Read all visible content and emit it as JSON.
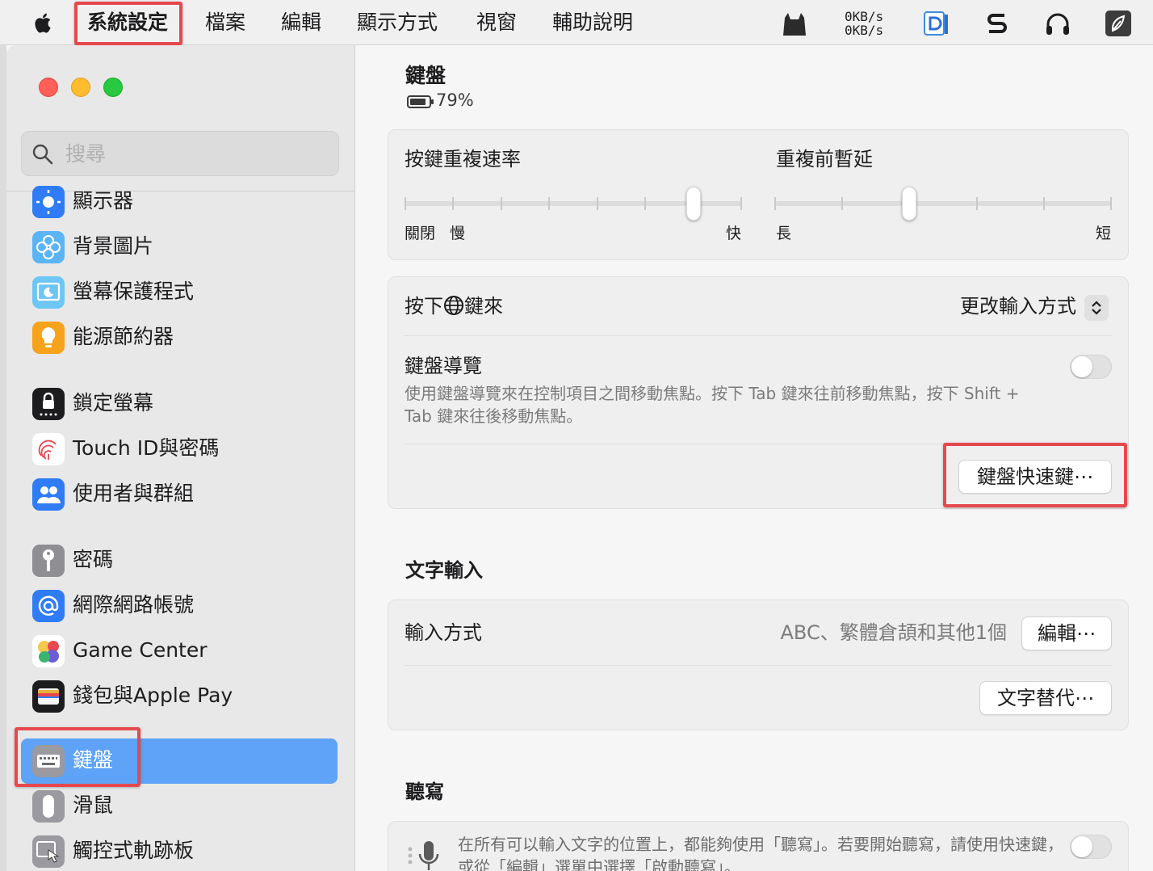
{
  "menubar": {
    "app_name": "系統設定",
    "items": [
      "檔案",
      "編輯",
      "顯示方式",
      "視窗",
      "輔助說明"
    ],
    "net_up": "0KB/s",
    "net_down": "0KB/s"
  },
  "sidebar": {
    "search_placeholder": "搜尋",
    "items": [
      {
        "label": "顯示器",
        "icon": "display-brightness-icon"
      },
      {
        "label": "背景圖片",
        "icon": "wallpaper-flower-icon"
      },
      {
        "label": "螢幕保護程式",
        "icon": "screensaver-icon"
      },
      {
        "label": "能源節約器",
        "icon": "lightbulb-icon"
      },
      {
        "label": "鎖定螢幕",
        "icon": "lock-screen-icon"
      },
      {
        "label": "Touch ID與密碼",
        "icon": "fingerprint-icon"
      },
      {
        "label": "使用者與群組",
        "icon": "users-icon"
      },
      {
        "label": "密碼",
        "icon": "key-icon"
      },
      {
        "label": "網際網路帳號",
        "icon": "at-sign-icon"
      },
      {
        "label": "Game Center",
        "icon": "game-center-icon"
      },
      {
        "label": "錢包與Apple Pay",
        "icon": "wallet-icon"
      },
      {
        "label": "鍵盤",
        "icon": "keyboard-icon",
        "selected": true
      },
      {
        "label": "滑鼠",
        "icon": "mouse-icon"
      },
      {
        "label": "觸控式軌跡板",
        "icon": "trackpad-icon"
      }
    ]
  },
  "content": {
    "title": "鍵盤",
    "battery_percent": "79%",
    "key_repeat": {
      "label": "按鍵重複速率",
      "min_off": "關閉",
      "min_label": "慢",
      "max_label": "快",
      "ticks": 8,
      "position_index": 6
    },
    "repeat_delay": {
      "label": "重複前暫延",
      "min_label": "長",
      "max_label": "短",
      "ticks": 6,
      "position_index": 2
    },
    "globe_key": {
      "label_prefix": "按下",
      "label_suffix": "鍵來",
      "value": "更改輸入方式"
    },
    "keyboard_nav": {
      "label": "鍵盤導覽",
      "description": "使用鍵盤導覽來在控制項目之間移動焦點。按下 Tab 鍵來往前移動焦點，按下 Shift + Tab 鍵來往後移動焦點。",
      "enabled": false
    },
    "shortcuts_button": "鍵盤快速鍵⋯",
    "text_input": {
      "section_title": "文字輸入",
      "input_sources_label": "輸入方式",
      "input_sources_value": "ABC、繁體倉頡和其他1個",
      "edit_button": "編輯⋯",
      "text_replacements_button": "文字替代⋯"
    },
    "dictation": {
      "section_title": "聽寫",
      "description": "在所有可以輸入文字的位置上，都能夠使用「聽寫」。若要開始聽寫，請使用快速鍵，或從「編輯」選單中選擇「啟動聽寫」。",
      "enabled": false
    }
  },
  "colors": {
    "highlight_box": "#e5484d",
    "selected_item": "#5ea3f7"
  }
}
